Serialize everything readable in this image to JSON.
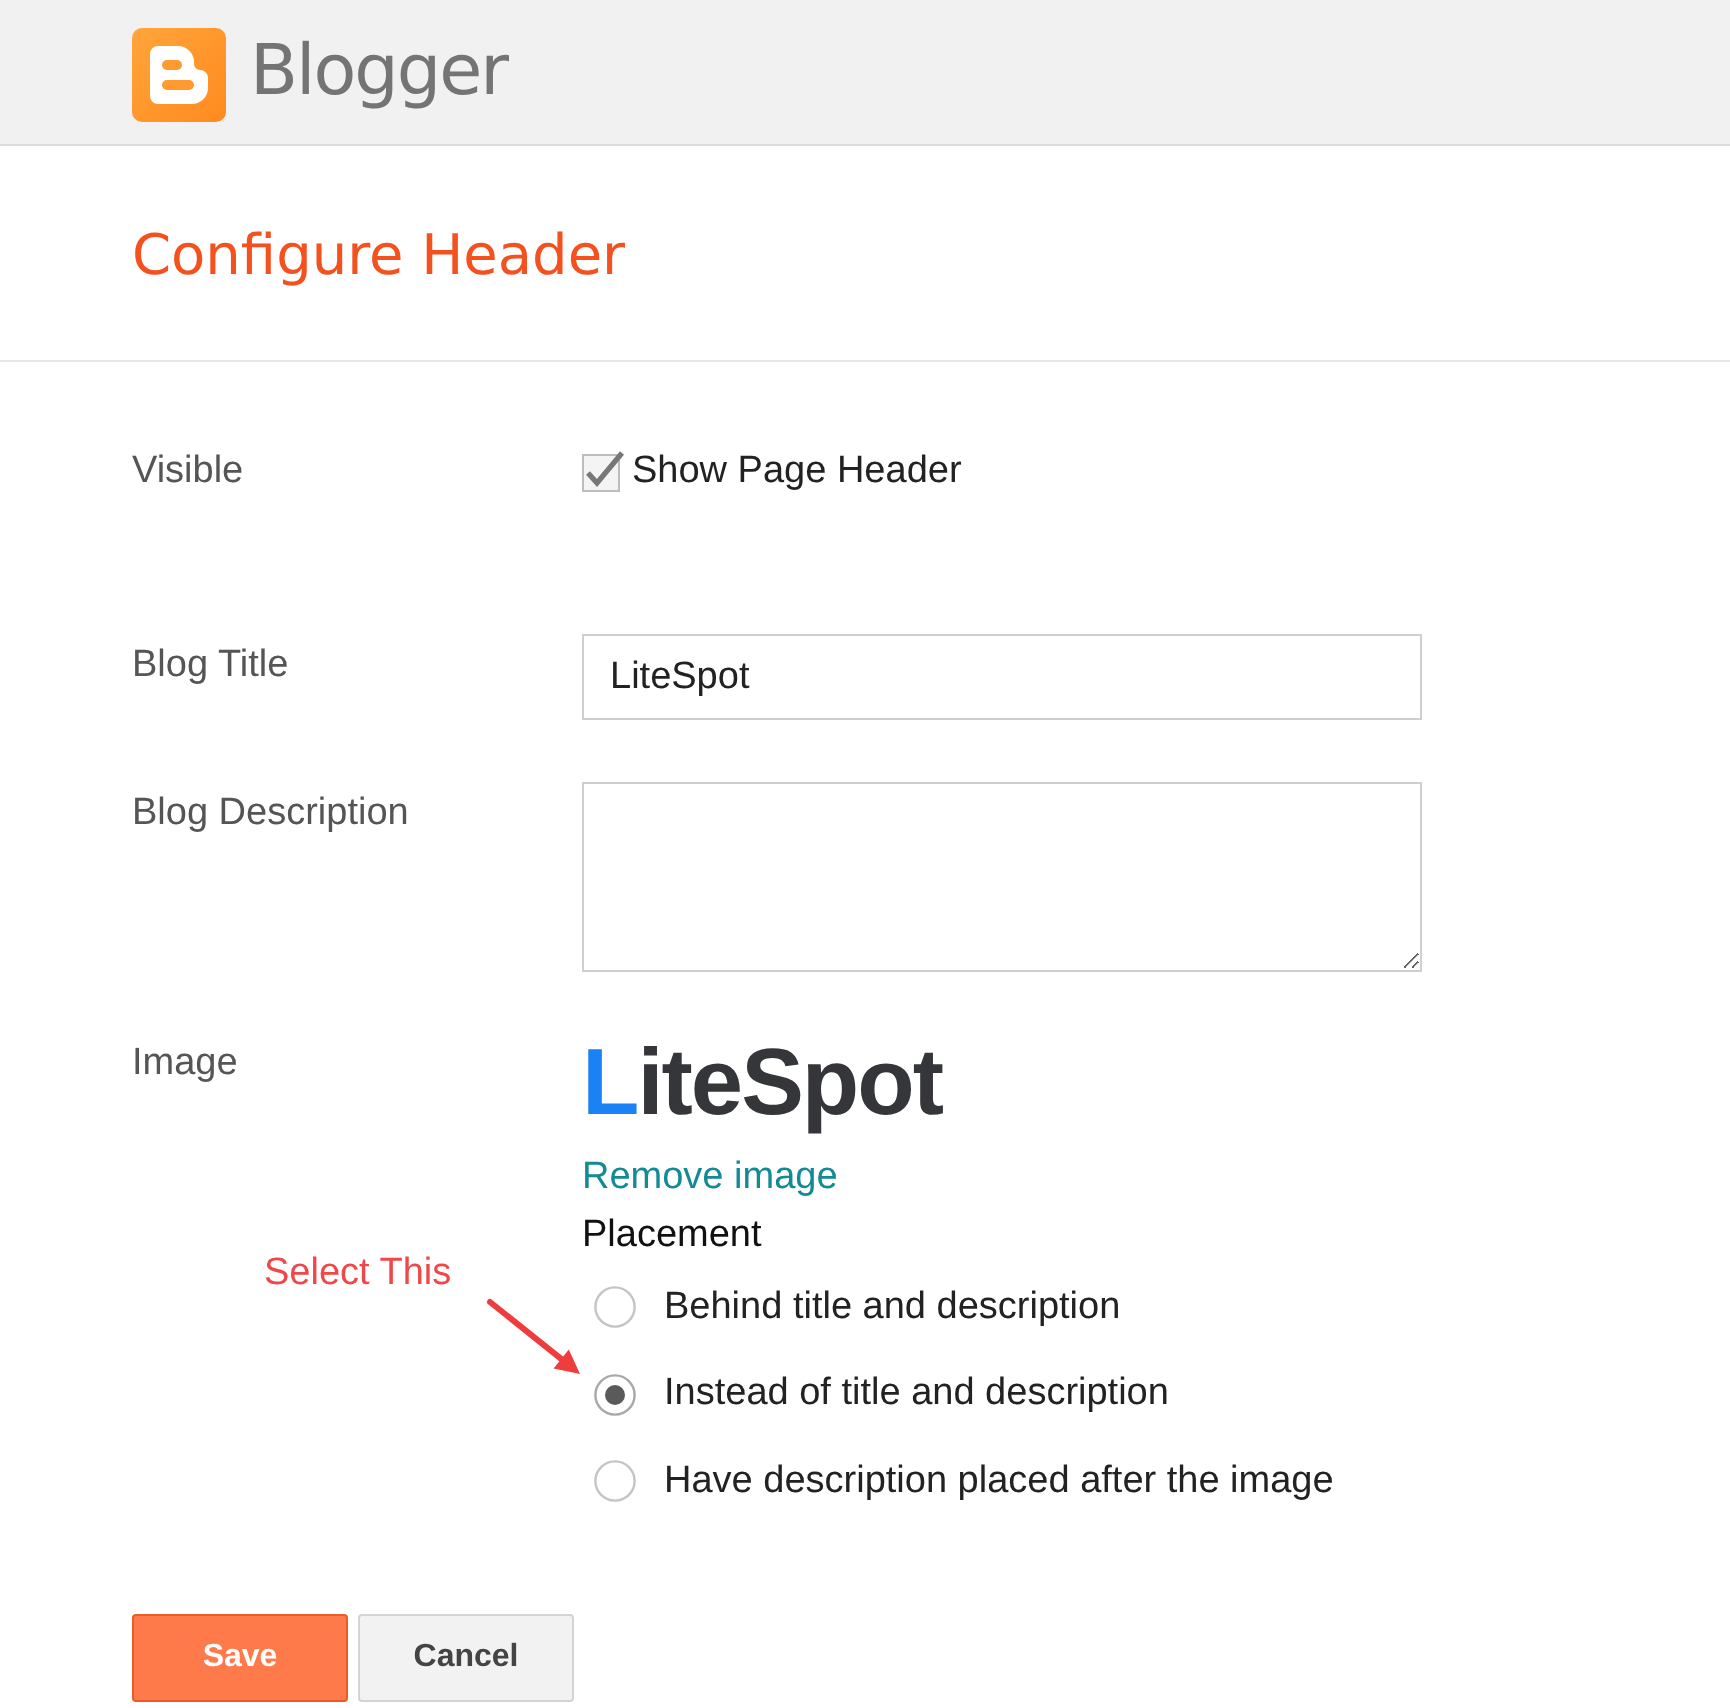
{
  "app_bar": {
    "brand": "Blogger"
  },
  "page_title": "Configure Header",
  "visible": {
    "label": "Visible",
    "checkbox": {
      "label": "Show Page Header",
      "checked": true
    }
  },
  "blog_title": {
    "label": "Blog Title",
    "value": "LiteSpot"
  },
  "blog_description": {
    "label": "Blog Description"
  },
  "image": {
    "label": "Image",
    "logo_text": "LiteSpot",
    "remove_link": "Remove image",
    "placement": {
      "label": "Placement",
      "options": [
        {
          "label": "Behind title and description",
          "selected": false
        },
        {
          "label": "Instead of title and description",
          "selected": true
        },
        {
          "label": "Have description placed after the image",
          "selected": false
        }
      ]
    }
  },
  "annotation": {
    "text": "Select This"
  },
  "buttons": [
    {
      "label": "Save",
      "kind": "primary"
    },
    {
      "label": "Cancel",
      "kind": "secondary"
    }
  ]
}
